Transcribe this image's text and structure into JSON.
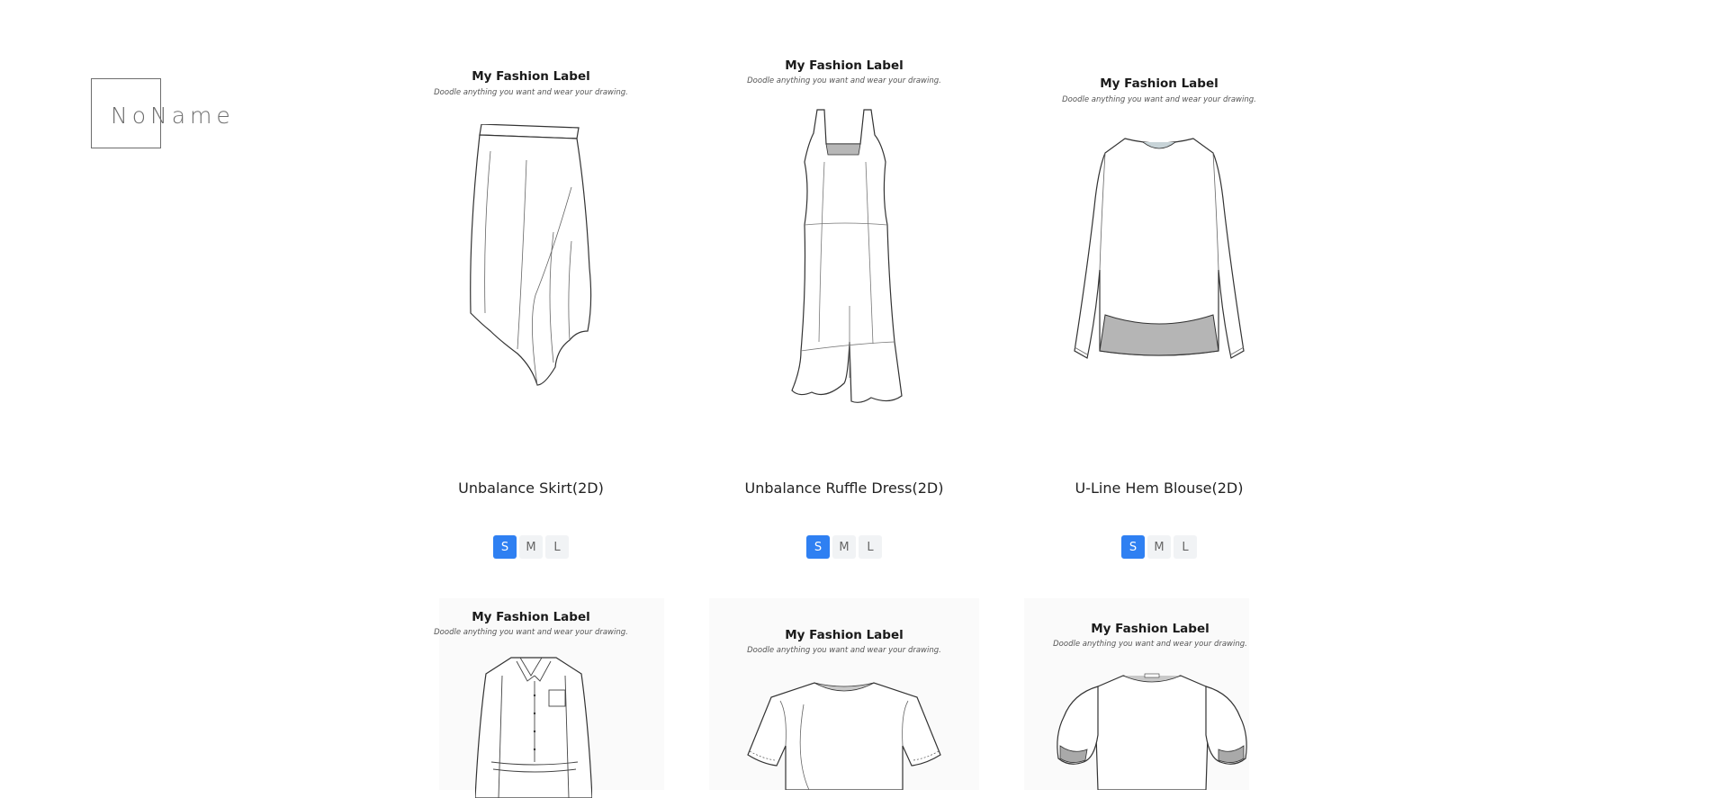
{
  "brand": {
    "logo_text": "NoName"
  },
  "accent_color": "#2f80f2",
  "products": [
    {
      "label_title": "My Fashion Label",
      "label_subtitle": "Doodle anything you want and wear your drawing.",
      "name": "Unbalance Skirt(2D)",
      "sizes": [
        "S",
        "M",
        "L"
      ],
      "selected_size": "S",
      "sketch_icon": "skirt-icon"
    },
    {
      "label_title": "My Fashion Label",
      "label_subtitle": "Doodle anything you want and wear your drawing.",
      "name": "Unbalance Ruffle Dress(2D)",
      "sizes": [
        "S",
        "M",
        "L"
      ],
      "selected_size": "S",
      "sketch_icon": "dress-icon"
    },
    {
      "label_title": "My Fashion Label",
      "label_subtitle": "Doodle anything you want and wear your drawing.",
      "name": "U-Line Hem Blouse(2D)",
      "sizes": [
        "S",
        "M",
        "L"
      ],
      "selected_size": "S",
      "sketch_icon": "blouse-icon"
    },
    {
      "label_title": "My Fashion Label",
      "label_subtitle": "Doodle anything you want and wear your drawing.",
      "sketch_icon": "shirt-dress-icon"
    },
    {
      "label_title": "My Fashion Label",
      "label_subtitle": "Doodle anything you want and wear your drawing.",
      "sketch_icon": "tshirt-icon"
    },
    {
      "label_title": "My Fashion Label",
      "label_subtitle": "Doodle anything you want and wear your drawing.",
      "sketch_icon": "puff-sleeve-top-icon"
    }
  ]
}
